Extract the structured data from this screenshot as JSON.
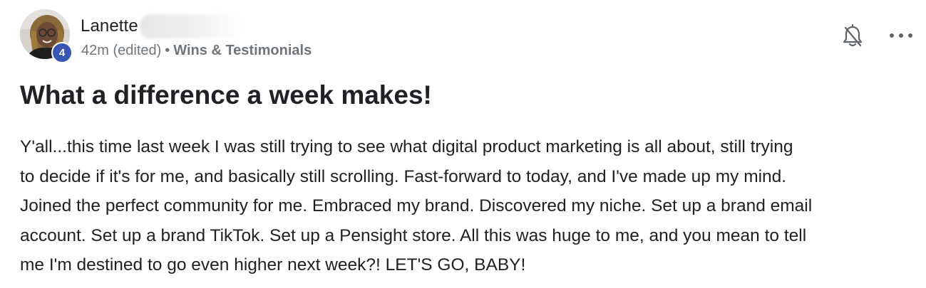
{
  "author": {
    "name": "Lanette",
    "level": "4",
    "avatar": "profile-photo"
  },
  "meta": {
    "time": "42m (edited)",
    "separator": "•",
    "category": "Wins & Testimonials"
  },
  "actions": {
    "notify_icon": "bell-off-icon",
    "more_icon": "more-horizontal-icon"
  },
  "post": {
    "title": "What a difference a week makes!",
    "body_lines": [
      "Y'all...this time last week I was still trying to see what digital product marketing is all about, still trying",
      "to decide if it's for me, and basically still scrolling. Fast-forward to today, and I've made up my mind.",
      "Joined the perfect community for me. Embraced my brand. Discovered my niche. Set up a brand email",
      "account. Set up a brand TikTok. Set up a Pensight store. All this was huge to me, and you mean to tell",
      "me I'm destined to go even higher next week?! LET'S GO, BABY!"
    ]
  },
  "colors": {
    "badge": "#3b55b3",
    "meta_text": "#70757a",
    "text": "#202124"
  }
}
